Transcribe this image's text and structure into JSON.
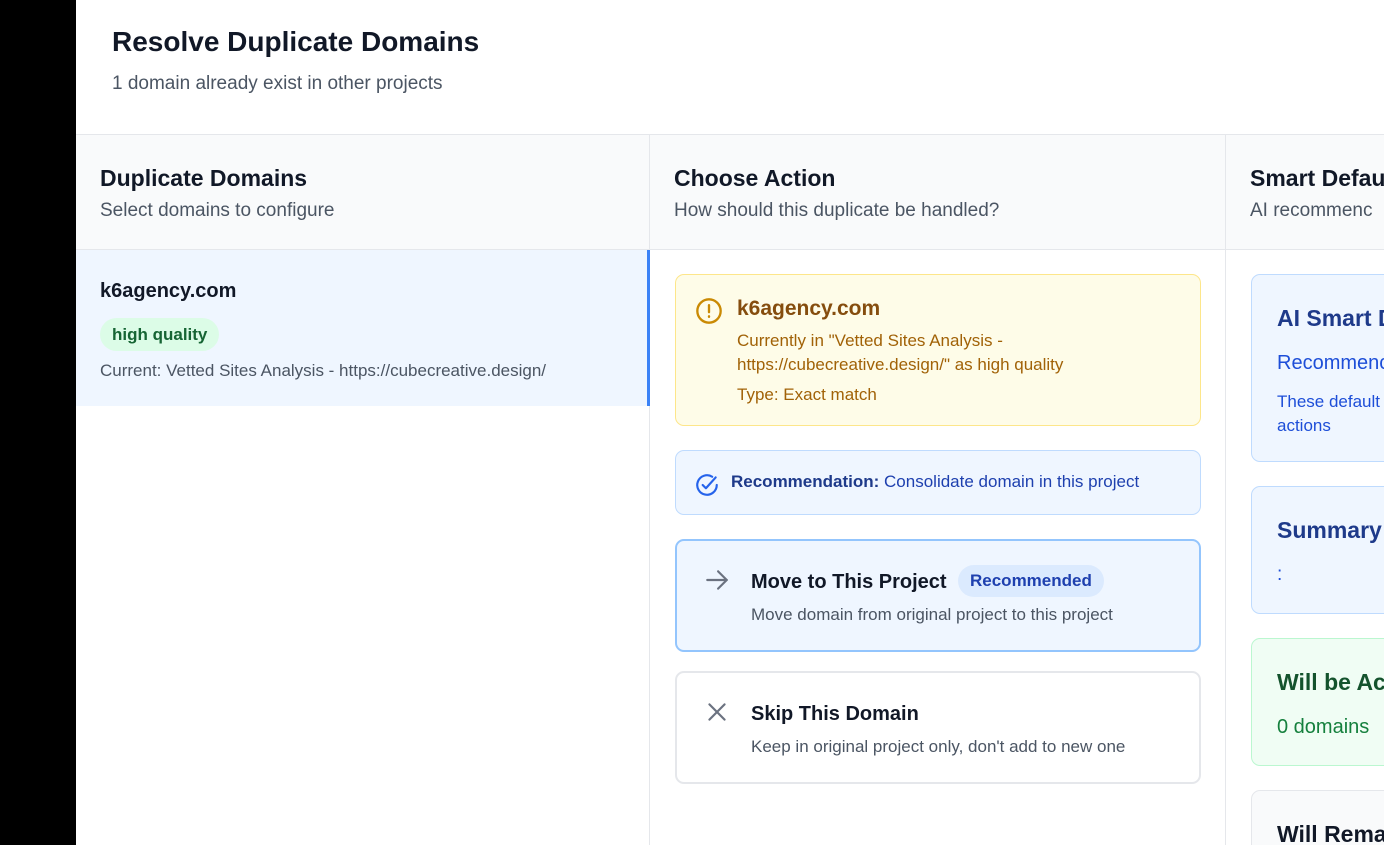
{
  "dialog": {
    "title": "Resolve Duplicate Domains",
    "subtitle": "1 domain already exist in other projects"
  },
  "duplicates_panel": {
    "title": "Duplicate Domains",
    "subtitle": "Select domains to configure",
    "items": [
      {
        "domain": "k6agency.com",
        "quality_badge": "high quality",
        "current": "Current: Vetted Sites Analysis - https://cubecreative.design/"
      }
    ]
  },
  "action_panel": {
    "title": "Choose Action",
    "subtitle": "How should this duplicate be handled?",
    "warning": {
      "domain": "k6agency.com",
      "line1": "Currently in \"Vetted Sites Analysis -",
      "line2": "https://cubecreative.design/\" as high quality",
      "type": "Type: Exact match"
    },
    "recommendation": {
      "label": "Recommendation:",
      "text": "Consolidate domain in this project"
    },
    "options": [
      {
        "title": "Move to This Project",
        "badge": "Recommended",
        "description": "Move domain from original project to this project"
      },
      {
        "title": "Skip This Domain",
        "description": "Keep in original project only, don't add to new one"
      }
    ]
  },
  "defaults_panel": {
    "title": "Smart Defau",
    "subtitle": "AI recommenc",
    "ai_card": {
      "title": "AI Smart D",
      "recommend": "Recommenc",
      "line1": "These default",
      "line2": "actions"
    },
    "summary_card": {
      "title": "Summary",
      "value": ":"
    },
    "added_card": {
      "title": "Will be Ac",
      "value": "0 domains"
    },
    "remain_card": {
      "title": "Will Rema"
    }
  },
  "colors": {
    "accent": "#3b82f6",
    "warning": "#a16207",
    "success": "#166534"
  }
}
